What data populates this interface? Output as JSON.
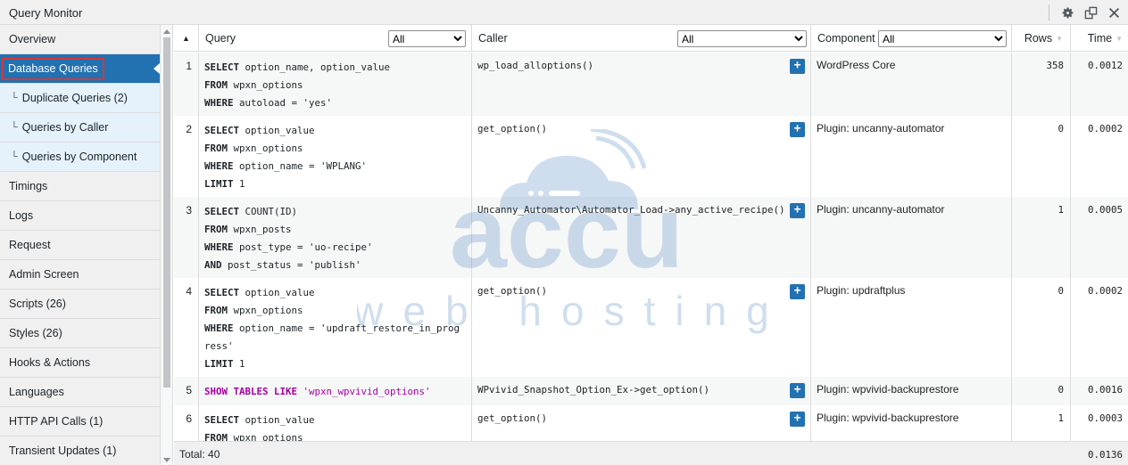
{
  "app": {
    "title": "Query Monitor",
    "controls": [
      "gear-icon",
      "pop-out-icon",
      "close-icon"
    ]
  },
  "sidebar": {
    "items": [
      {
        "label": "Overview",
        "type": "top"
      },
      {
        "label": "Database Queries",
        "type": "active"
      },
      {
        "label": "Duplicate Queries (2)",
        "type": "sub",
        "branch": "└"
      },
      {
        "label": "Queries by Caller",
        "type": "sub",
        "branch": "└"
      },
      {
        "label": "Queries by Component",
        "type": "sub",
        "branch": "└"
      },
      {
        "label": "Timings",
        "type": "top"
      },
      {
        "label": "Logs",
        "type": "top"
      },
      {
        "label": "Request",
        "type": "top"
      },
      {
        "label": "Admin Screen",
        "type": "top"
      },
      {
        "label": "Scripts (26)",
        "type": "top"
      },
      {
        "label": "Styles (26)",
        "type": "top"
      },
      {
        "label": "Hooks & Actions",
        "type": "top"
      },
      {
        "label": "Languages",
        "type": "top"
      },
      {
        "label": "HTTP API Calls (1)",
        "type": "top"
      },
      {
        "label": "Transient Updates (1)",
        "type": "top"
      }
    ]
  },
  "table": {
    "headers": {
      "sort_glyph": "▲",
      "query": "Query",
      "query_filter": "All",
      "caller": "Caller",
      "caller_filter": "All",
      "component": "Component",
      "component_filter": "All",
      "rows": "Rows",
      "time": "Time"
    },
    "rows": [
      {
        "n": "1",
        "sql": [
          [
            "SELECT",
            " option_name, option_value"
          ],
          [
            "FROM",
            " wpxn_options"
          ],
          [
            "WHERE",
            " autoload = 'yes'"
          ]
        ],
        "caller": "wp_load_alloptions()",
        "component": "WordPress Core",
        "rows": "358",
        "time": "0.0012"
      },
      {
        "n": "2",
        "sql": [
          [
            "SELECT",
            " option_value"
          ],
          [
            "FROM",
            " wpxn_options"
          ],
          [
            "WHERE",
            " option_name = 'WPLANG'"
          ],
          [
            "LIMIT",
            " 1"
          ]
        ],
        "caller": "get_option()",
        "component": "Plugin: uncanny-automator",
        "rows": "0",
        "time": "0.0002"
      },
      {
        "n": "3",
        "sql": [
          [
            "SELECT",
            " COUNT(ID)"
          ],
          [
            "FROM",
            " wpxn_posts"
          ],
          [
            "WHERE",
            " post_type = 'uo-recipe'"
          ],
          [
            "AND",
            " post_status = 'publish'"
          ]
        ],
        "caller": "Uncanny_Automator\\Automator_Load->any_active_recipe()",
        "component": "Plugin: uncanny-automator",
        "rows": "1",
        "time": "0.0005"
      },
      {
        "n": "4",
        "sql": [
          [
            "SELECT",
            " option_value"
          ],
          [
            "FROM",
            " wpxn_options"
          ],
          [
            "WHERE",
            " option_name = 'updraft_restore_in_prog\nress'"
          ],
          [
            "LIMIT",
            " 1"
          ]
        ],
        "caller": "get_option()",
        "component": "Plugin: updraftplus",
        "rows": "0",
        "time": "0.0002"
      },
      {
        "n": "5",
        "sql": [
          [
            "SHOW TABLES LIKE",
            " 'wpxn_wpvivid_options'"
          ]
        ],
        "purple": true,
        "caller": "WPvivid_Snapshot_Option_Ex->get_option()",
        "component": "Plugin: wpvivid-backuprestore",
        "rows": "0",
        "time": "0.0016"
      },
      {
        "n": "6",
        "sql": [
          [
            "SELECT",
            " option_value"
          ],
          [
            "FROM",
            " wpxn_options"
          ]
        ],
        "caller": "get_option()",
        "component": "Plugin: wpvivid-backuprestore",
        "rows": "1",
        "time": "0.0003"
      }
    ],
    "plus_label": "+",
    "footer": {
      "total": "Total: 40",
      "time_sum": "0.0136"
    }
  },
  "watermark": {
    "brand": "accu",
    "tagline": "web hosting",
    "color": "#2a6fb5"
  },
  "colors": {
    "accent": "#2271b1",
    "highlight_box": "#d63638",
    "sub_item_bg": "#e5f1fb",
    "sql_purple": "#a400a4"
  }
}
